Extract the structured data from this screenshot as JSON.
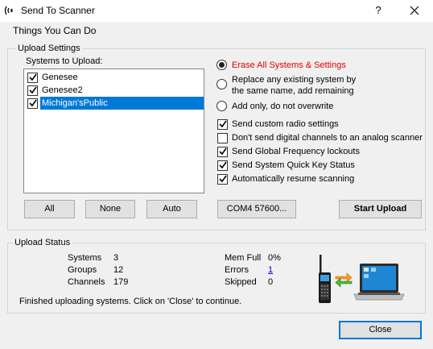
{
  "window": {
    "title": "Send To Scanner",
    "help_glyph": "?",
    "close_glyph": "✕"
  },
  "heading": "Things You Can Do",
  "upload_settings": {
    "group_title": "Upload Settings",
    "systems_label": "Systems to Upload:",
    "systems": [
      {
        "name": "Genesee",
        "checked": true,
        "selected": false
      },
      {
        "name": "Genesee2",
        "checked": true,
        "selected": false
      },
      {
        "name": "Michigan'sPublic",
        "checked": true,
        "selected": true
      }
    ],
    "radio_options": [
      {
        "label": "Erase All Systems & Settings",
        "selected": true,
        "color": "#e00000"
      },
      {
        "label_line1": "Replace any existing system by",
        "label_line2": "the same name, add remaining",
        "selected": false
      },
      {
        "label": "Add only, do not overwrite",
        "selected": false
      }
    ],
    "check_options": [
      {
        "label": "Send custom radio settings",
        "checked": true
      },
      {
        "label": "Don't send digital channels to an analog scanner",
        "checked": false
      },
      {
        "label": "Send Global Frequency lockouts",
        "checked": true
      },
      {
        "label": "Send System Quick Key Status",
        "checked": true
      },
      {
        "label": "Automatically resume scanning",
        "checked": true
      }
    ],
    "buttons": {
      "all": "All",
      "none": "None",
      "auto": "Auto",
      "port": "COM4 57600...",
      "start": "Start Upload"
    }
  },
  "upload_status": {
    "group_title": "Upload Status",
    "systems_label": "Systems",
    "systems_value": "3",
    "groups_label": "Groups",
    "groups_value": "12",
    "channels_label": "Channels",
    "channels_value": "179",
    "memfull_label": "Mem Full",
    "memfull_value": "0%",
    "errors_label": "Errors",
    "errors_value": "1",
    "skipped_label": "Skipped",
    "skipped_value": "0",
    "message": "Finished uploading systems. Click on 'Close' to continue."
  },
  "footer": {
    "close_label": "Close"
  },
  "colors": {
    "accent": "#0078d7",
    "erase_red": "#e00000",
    "link": "#0000ee"
  }
}
